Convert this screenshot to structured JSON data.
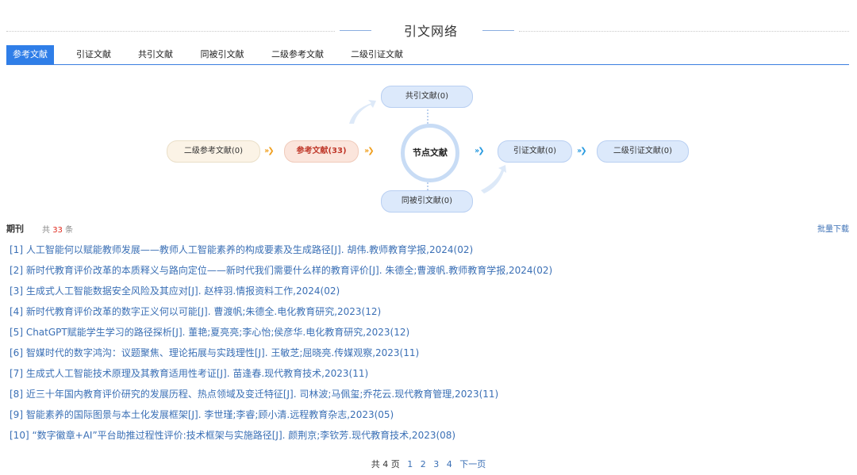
{
  "header": {
    "title": "引文网络"
  },
  "tabs": [
    "参考文献",
    "引证文献",
    "共引文献",
    "同被引文献",
    "二级参考文献",
    "二级引证文献"
  ],
  "diagram": {
    "cocite": "共引文献(0)",
    "secondary_ref": "二级参考文献(0)",
    "ref": "参考文献(33)",
    "node": "节点文献",
    "citing": "引证文献(0)",
    "secondary_citing": "二级引证文献(0)",
    "cocited": "同被引文献(0)"
  },
  "section": {
    "label": "期刊",
    "count_prefix": "共",
    "count": "33",
    "count_suffix": "条",
    "batch_download": "批量下载"
  },
  "items": [
    "[1] 人工智能何以赋能教师发展——教师人工智能素养的构成要素及生成路径[J]. 胡伟.教师教育学报,2024(02)",
    "[2] 新时代教育评价改革的本质释义与路向定位——新时代我们需要什么样的教育评价[J]. 朱德全;曹渡帆.教师教育学报,2024(02)",
    "[3] 生成式人工智能数据安全风险及其应对[J]. 赵梓羽.情报资料工作,2024(02)",
    "[4] 新时代教育评价改革的数字正义何以可能[J]. 曹渡帆;朱德全.电化教育研究,2023(12)",
    "[5] ChatGPT赋能学生学习的路径探析[J]. 董艳;夏亮亮;李心怡;侯彦华.电化教育研究,2023(12)",
    "[6] 智媒时代的数字鸿沟：议题聚焦、理论拓展与实践理性[J]. 王敏芝;屈晓亮.传媒观察,2023(11)",
    "[7] 生成式人工智能技术原理及其教育适用性考证[J]. 苗逢春.现代教育技术,2023(11)",
    "[8] 近三十年国内教育评价研究的发展历程、热点领域及变迁特征[J]. 司林波;马佩玺;乔花云.现代教育管理,2023(11)",
    "[9] 智能素养的国际图景与本土化发展框架[J]. 李世瑾;李睿;顾小清.远程教育杂志,2023(05)",
    "[10] “数字徽章+AI”平台助推过程性评价:技术框架与实施路径[J]. 颜荆京;李钦芳.现代教育技术,2023(08)"
  ],
  "pager": {
    "total": "共 4 页",
    "pages": [
      "1",
      "2",
      "3",
      "4"
    ],
    "next": "下一页"
  },
  "colors": {
    "accent": "#2f7ee8",
    "link": "#3a6fb5",
    "count_red": "#e0281c"
  }
}
